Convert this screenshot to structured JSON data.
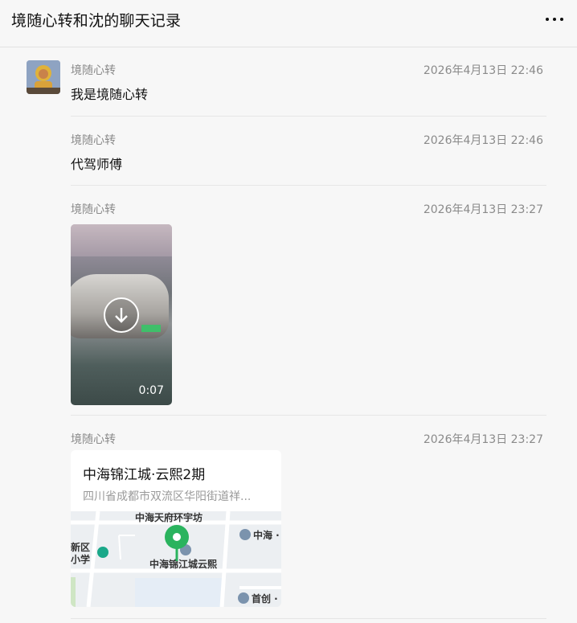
{
  "header": {
    "title": "境随心转和沈的聊天记录",
    "more_icon": "more-horizontal-icon"
  },
  "messages": [
    {
      "sender": "境随心转",
      "time": "2026年4月13日 22:46",
      "type": "text",
      "text": "我是境随心转"
    },
    {
      "sender": "境随心转",
      "time": "2026年4月13日 22:46",
      "type": "text",
      "text": "代驾师傅"
    },
    {
      "sender": "境随心转",
      "time": "2026年4月13日 23:27",
      "type": "video",
      "duration": "0:07",
      "icon": "download-icon"
    },
    {
      "sender": "境随心转",
      "time": "2026年4月13日 23:27",
      "type": "location",
      "title": "中海锦江城·云熙2期",
      "address": "四川省成都市双流区华阳街道祥...",
      "map_labels": {
        "top": "中海天府环宇坊",
        "poi_right_top": "中海 ·",
        "left_1": "新区",
        "left_2": "小学",
        "center": "中海锦江城云熙",
        "poi_right_bottom": "首创 ·"
      }
    }
  ],
  "colors": {
    "accent_green": "#2ab35e",
    "poi_blue": "#7b93ad"
  }
}
